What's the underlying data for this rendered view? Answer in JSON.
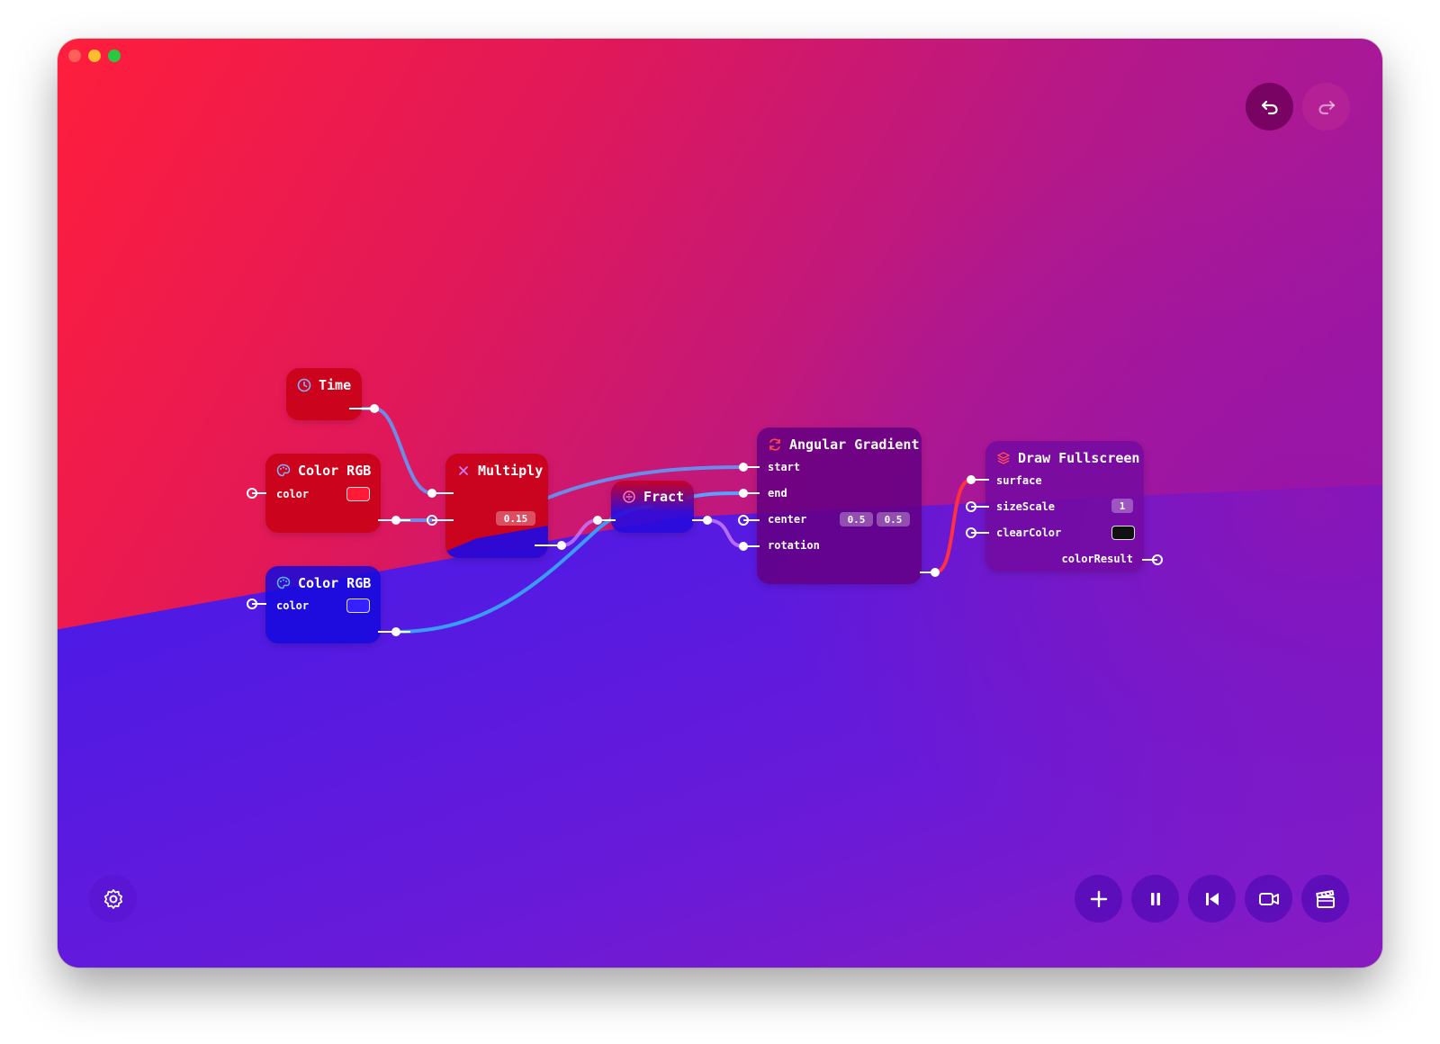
{
  "toolbar_top": {
    "undo_icon": "undo-arrow-icon",
    "redo_icon": "redo-arrow-icon"
  },
  "nodes": {
    "time": {
      "title": "Time",
      "icon": "clock-icon"
    },
    "color_rgb_red": {
      "title": "Color RGB",
      "icon": "palette-icon",
      "port_color": "color",
      "swatch_color": "#ff1a35"
    },
    "color_rgb_blue": {
      "title": "Color RGB",
      "icon": "palette-icon",
      "port_color": "color",
      "swatch_color": "#3520ff"
    },
    "multiply": {
      "title": "Multiply",
      "icon": "multiply-icon",
      "value": "0.15"
    },
    "fract": {
      "title": "Fract",
      "icon": "fract-icon"
    },
    "angular_gradient": {
      "title": "Angular Gradient",
      "icon": "refresh-icon",
      "ports": {
        "start": "start",
        "end": "end",
        "center": "center",
        "rotation": "rotation"
      },
      "center_x": "0.5",
      "center_y": "0.5"
    },
    "draw_fullscreen": {
      "title": "Draw Fullscreen",
      "icon": "layers-icon",
      "ports": {
        "surface": "surface",
        "sizeScale": "sizeScale",
        "clearColor": "clearColor",
        "colorResult": "colorResult"
      },
      "size_scale": "1",
      "clear_color": "#111111"
    }
  },
  "bottom_toolbar": {
    "settings_icon": "gear-icon",
    "buttons": [
      "plus-icon",
      "pause-icon",
      "skip-back-icon",
      "video-camera-icon",
      "clapperboard-icon"
    ]
  },
  "colors": {
    "wire_blue": "#5aa0ff",
    "wire_red": "#ff3040",
    "wire_purple": "#c87aff"
  }
}
